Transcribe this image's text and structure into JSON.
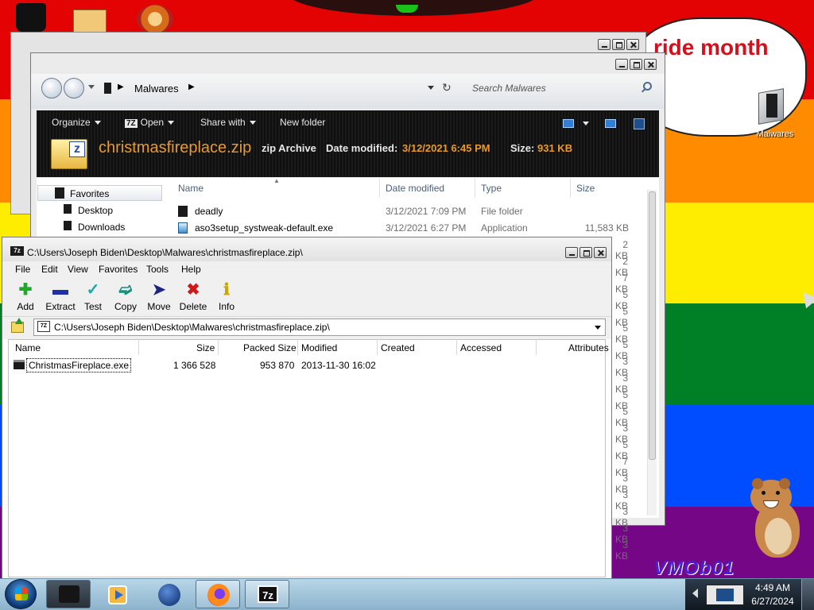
{
  "desktop": {
    "speech_bubble_text": "ride month",
    "icons": [
      {
        "label": "Malwares"
      }
    ],
    "watermark": "VMOb01"
  },
  "explorer": {
    "breadcrumb": "Malwares",
    "search_placeholder": "Search Malwares",
    "commands": {
      "organize": "Organize",
      "open_badge": "7Z",
      "open": "Open",
      "share_with": "Share with",
      "new_folder": "New folder"
    },
    "details": {
      "file_name": "christmasfireplace.zip",
      "file_type": "zip Archive",
      "date_modified_label": "Date modified:",
      "date_modified": "3/12/2021 6:45 PM",
      "size_label": "Size:",
      "size": "931 KB"
    },
    "navigation": {
      "favorites": "Favorites",
      "items": [
        "Desktop",
        "Downloads"
      ]
    },
    "columns": [
      "Name",
      "Date modified",
      "Type",
      "Size"
    ],
    "files": [
      {
        "name": "deadly",
        "date": "3/12/2021 7:09 PM",
        "type": "File folder",
        "size": ""
      },
      {
        "name": "aso3setup_systweak-default.exe",
        "date": "3/12/2021 6:27 PM",
        "type": "Application",
        "size": "11,583 KB"
      }
    ],
    "partial_sizes": [
      "2 KB",
      "2 KB",
      "7 KB",
      "5 KB",
      "5 KB",
      "5 KB",
      "5 KB",
      "3 KB",
      "3 KB",
      "5 KB",
      "5 KB",
      "3 KB",
      "5 KB",
      "7 KB",
      "3 KB",
      "3 KB",
      "3 KB",
      "3 KB",
      "3 KB",
      "3 KB"
    ]
  },
  "sevenzip": {
    "title": "C:\\Users\\Joseph Biden\\Desktop\\Malwares\\christmasfireplace.zip\\",
    "title_icon": "7z",
    "menu": [
      "File",
      "Edit",
      "View",
      "Favorites",
      "Tools",
      "Help"
    ],
    "toolbar": {
      "add": "Add",
      "extract": "Extract",
      "test": "Test",
      "copy": "Copy",
      "move": "Move",
      "delete": "Delete",
      "info": "Info"
    },
    "address_icon": "7Z",
    "address": "C:\\Users\\Joseph Biden\\Desktop\\Malwares\\christmasfireplace.zip\\",
    "columns": [
      "Name",
      "Size",
      "Packed Size",
      "Modified",
      "Created",
      "Accessed",
      "Attributes"
    ],
    "items": [
      {
        "name": "ChristmasFireplace.exe",
        "size": "1 366 528",
        "packed_size": "953 870",
        "modified": "2013-11-30 16:02"
      }
    ]
  },
  "taskbar": {
    "sevenzip_label": "7z",
    "clock_time": "4:49 AM",
    "clock_date": "6/27/2024"
  },
  "colors": {
    "explorer_accent": "#e89a2c",
    "flag": [
      "#e40303",
      "#ff8c00",
      "#ffed00",
      "#008026",
      "#004dff",
      "#750787"
    ]
  }
}
